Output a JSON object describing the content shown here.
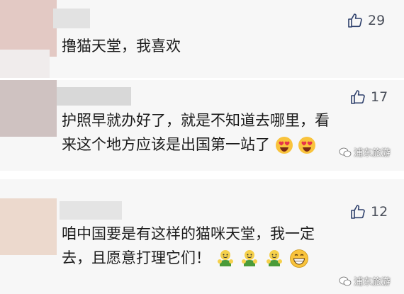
{
  "comments": [
    {
      "likes": "29",
      "text": "撸猫天堂，我喜欢",
      "avatar_color": "#e3c9c4"
    },
    {
      "likes": "17",
      "text_line1": "护照早就办好了，就是不知道去哪里，看",
      "text_line2": "来这个地方应该是出国第一站了",
      "avatar_color": "#cfc2c1"
    },
    {
      "likes": "12",
      "text_line1": "咱中国要是有这样的猫咪天堂，我一定",
      "text_line2": "去，且愿意打理它们！",
      "avatar_color": "#ecd9cd"
    }
  ],
  "watermark": {
    "text": "浦东旅游"
  },
  "colors": {
    "background": "#f7f7f7",
    "text": "#1b1b1b",
    "like_icon": "#2d3f6b"
  },
  "icons": [
    "thumbs-up-icon",
    "heart-eyes-emoji",
    "grinning-emoji",
    "thumbs-up-figure-emoji",
    "wechat-watermark-icon"
  ]
}
